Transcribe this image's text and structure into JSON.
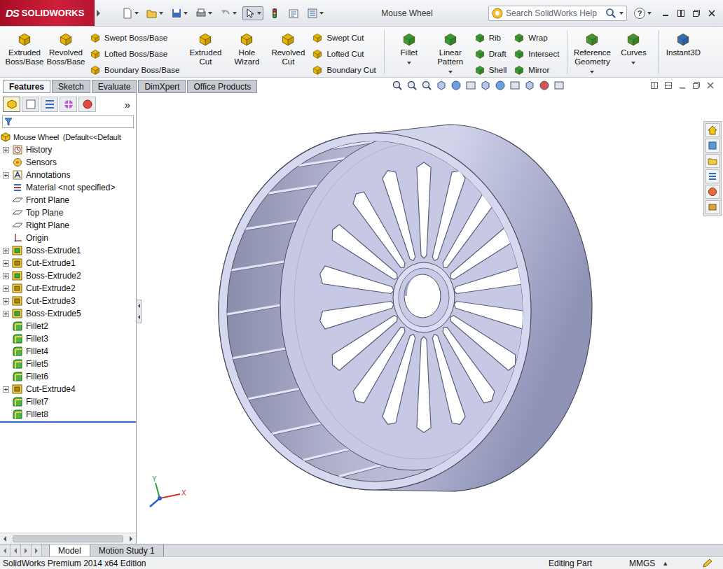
{
  "window": {
    "title": "Mouse Wheel"
  },
  "logo": {
    "mark": "DS",
    "name": "SOLIDWORKS"
  },
  "search": {
    "placeholder": "Search SolidWorks Help"
  },
  "help": "?",
  "ribbon": {
    "groups": [
      {
        "large": [
          {
            "label": "Extruded Boss/Base",
            "dropdown": false
          },
          {
            "label": "Revolved Boss/Base",
            "dropdown": false
          }
        ],
        "columns": [
          [
            "Swept Boss/Base",
            "Lofted Boss/Base",
            "Boundary Boss/Base"
          ]
        ]
      },
      {
        "large": [
          {
            "label": "Extruded Cut",
            "dropdown": false
          },
          {
            "label": "Hole Wizard",
            "dropdown": false
          },
          {
            "label": "Revolved Cut",
            "dropdown": false
          }
        ],
        "columns": [
          [
            "Swept Cut",
            "Lofted Cut",
            "Boundary Cut"
          ]
        ]
      },
      {
        "large": [
          {
            "label": "Fillet",
            "dropdown": true
          },
          {
            "label": "Linear Pattern",
            "dropdown": true
          }
        ],
        "columns": [
          [
            "Rib",
            "Draft",
            "Shell"
          ],
          [
            "Wrap",
            "Intersect",
            "Mirror"
          ]
        ]
      },
      {
        "large": [
          {
            "label": "Reference Geometry",
            "dropdown": true
          },
          {
            "label": "Curves",
            "dropdown": true
          }
        ],
        "columns": []
      },
      {
        "large": [
          {
            "label": "Instant3D",
            "dropdown": false
          }
        ],
        "columns": []
      }
    ]
  },
  "tabs": [
    {
      "label": "Features",
      "selected": true
    },
    {
      "label": "Sketch",
      "selected": false
    },
    {
      "label": "Evaluate",
      "selected": false
    },
    {
      "label": "DimXpert",
      "selected": false
    },
    {
      "label": "Office Products",
      "selected": false
    }
  ],
  "panel_tabs": {
    "items": [
      {
        "selected": true
      },
      {
        "selected": false
      },
      {
        "selected": false
      },
      {
        "selected": false
      },
      {
        "selected": false
      }
    ],
    "more": "»"
  },
  "tree": {
    "root": {
      "label": "Mouse Wheel  (Default<<Default",
      "kind": "part"
    },
    "items": [
      {
        "label": "History",
        "kind": "history",
        "expandable": true,
        "expanded": false
      },
      {
        "label": "Sensors",
        "kind": "sensors",
        "expandable": false,
        "expanded": false
      },
      {
        "label": "Annotations",
        "kind": "annotations",
        "expandable": true,
        "expanded": false
      },
      {
        "label": "Material <not specified>",
        "kind": "material",
        "expandable": false,
        "expanded": false
      },
      {
        "label": "Front Plane",
        "kind": "plane",
        "expandable": false,
        "expanded": false
      },
      {
        "label": "Top Plane",
        "kind": "plane",
        "expandable": false,
        "expanded": false
      },
      {
        "label": "Right Plane",
        "kind": "plane",
        "expandable": false,
        "expanded": false
      },
      {
        "label": "Origin",
        "kind": "origin",
        "expandable": false,
        "expanded": false
      },
      {
        "label": "Boss-Extrude1",
        "kind": "extrude",
        "expandable": true,
        "expanded": false
      },
      {
        "label": "Cut-Extrude1",
        "kind": "cut",
        "expandable": true,
        "expanded": false
      },
      {
        "label": "Boss-Extrude2",
        "kind": "extrude",
        "expandable": true,
        "expanded": false
      },
      {
        "label": "Cut-Extrude2",
        "kind": "cut",
        "expandable": true,
        "expanded": false
      },
      {
        "label": "Cut-Extrude3",
        "kind": "cut",
        "expandable": true,
        "expanded": false
      },
      {
        "label": "Boss-Extrude5",
        "kind": "extrude",
        "expandable": true,
        "expanded": false
      },
      {
        "label": "Fillet2",
        "kind": "fillet",
        "expandable": false,
        "expanded": false
      },
      {
        "label": "Fillet3",
        "kind": "fillet",
        "expandable": false,
        "expanded": false
      },
      {
        "label": "Fillet4",
        "kind": "fillet",
        "expandable": false,
        "expanded": false
      },
      {
        "label": "Fillet5",
        "kind": "fillet",
        "expandable": false,
        "expanded": false
      },
      {
        "label": "Fillet6",
        "kind": "fillet",
        "expandable": false,
        "expanded": false
      },
      {
        "label": "Cut-Extrude4",
        "kind": "cut",
        "expandable": true,
        "expanded": false
      },
      {
        "label": "Fillet7",
        "kind": "fillet",
        "expandable": false,
        "expanded": false
      },
      {
        "label": "Fillet8",
        "kind": "fillet",
        "expandable": false,
        "expanded": false
      }
    ]
  },
  "triad": {
    "labels": [
      "Y",
      "X"
    ]
  },
  "bottom_tabs": [
    {
      "label": "Model",
      "selected": true
    },
    {
      "label": "Motion Study 1",
      "selected": false
    }
  ],
  "status_bar": {
    "edition": "SolidWorks Premium 2014 x64 Edition",
    "mode": "Editing Part",
    "units": "MMGS",
    "units_arrow": "▲"
  }
}
